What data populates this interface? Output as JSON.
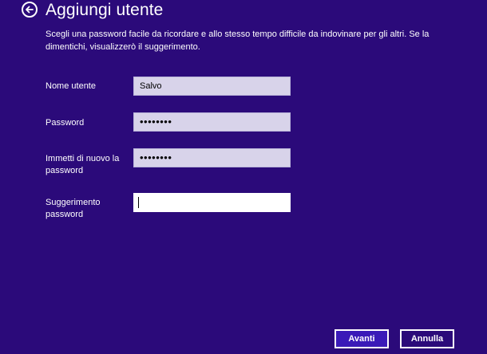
{
  "header": {
    "title": "Aggiungi utente",
    "back_icon": "back-arrow-icon"
  },
  "instructions": "Scegli una password facile da ricordare e allo stesso tempo difficile da indovinare per gli altri. Se la dimentichi, visualizzerò il suggerimento.",
  "form": {
    "username": {
      "label": "Nome utente",
      "value": "Salvo"
    },
    "password": {
      "label": "Password",
      "masked_value": "••••••••"
    },
    "confirm_password": {
      "label": "Immetti di nuovo la password",
      "masked_value": "••••••••"
    },
    "hint": {
      "label": "Suggerimento password",
      "value": ""
    }
  },
  "buttons": {
    "next_label": "Avanti",
    "cancel_label": "Annulla"
  },
  "colors": {
    "background": "#2b0a7a",
    "primary_button": "#3a1ab8",
    "input_background": "#d8d3ea",
    "text": "#ffffff"
  }
}
